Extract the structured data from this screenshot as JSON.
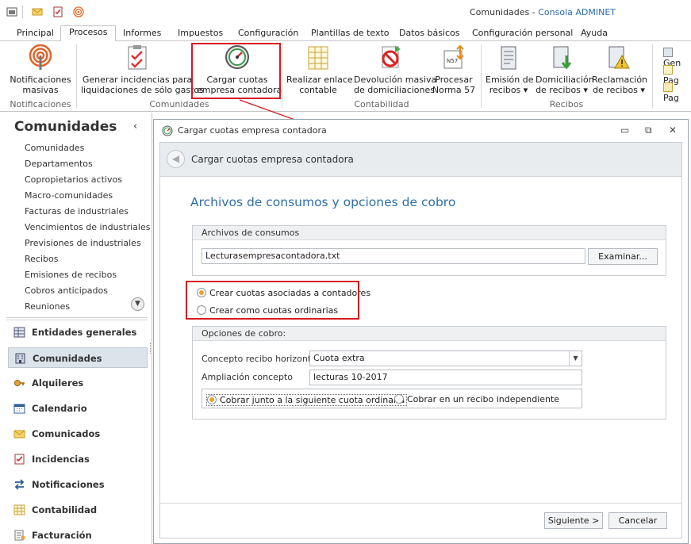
{
  "window": {
    "title_main": "Comunidades - ",
    "title_accent": "Consola ADMINET"
  },
  "ribbon_tabs": [
    "Principal",
    "Procesos",
    "Informes",
    "Impuestos",
    "Configuración",
    "Plantillas de texto",
    "Datos básicos",
    "Configuración personal",
    "Ayuda"
  ],
  "ribbon": {
    "buttons": {
      "notificaciones": "Notificaciones\nmasivas",
      "generar": "Generar incidencias para\nliquidaciones de sólo gastos",
      "cargar": "Cargar cuotas\nempresa contadora",
      "realizar": "Realizar enlace\ncontable",
      "devolucion": "Devolución masiva\nde domiciliaciones",
      "procesar": "Procesar\nNorma 57",
      "emision": "Emisión de\nrecibos ▾",
      "domiciliacion": "Domiciliación\nde recibos ▾",
      "reclamacion": "Reclamación\nde recibos ▾"
    },
    "groups": {
      "notificaciones": "Notificaciones",
      "comunidades": "Comunidades",
      "contabilidad": "Contabilidad",
      "recibos": "Recibos"
    },
    "small_buttons": [
      "Gen",
      "Pag",
      "Pag"
    ]
  },
  "leftnav": {
    "title": "Comunidades",
    "collapse_glyph": "‹",
    "sub_items": [
      "Comunidades",
      "Departamentos",
      "Copropietarios activos",
      "Macro-comunidades",
      "Facturas de industriales",
      "Vencimientos de industriales",
      "Previsiones de industriales",
      "Recibos",
      "Emisiones de recibos",
      "Cobros anticipados",
      "Reuniones"
    ],
    "main_items": [
      "Entidades generales",
      "Comunidades",
      "Alquileres",
      "Calendario",
      "Comunicados",
      "Incidencias",
      "Notificaciones",
      "Contabilidad",
      "Facturación"
    ]
  },
  "dialog": {
    "title": "Cargar cuotas empresa contadora",
    "header_title": "Cargar cuotas empresa contadora",
    "section_title": "Archivos de consumos y opciones de cobro",
    "archivos": {
      "heading": "Archivos de consumos",
      "file_value": "Lecturasempresacontadora.txt",
      "browse_label": "Examinar..."
    },
    "mode": {
      "option1": "Crear cuotas asociadas a contadores",
      "option2": "Crear como cuotas ordinarias",
      "selected": 1
    },
    "opciones": {
      "heading": "Opciones de cobro:",
      "concepto_label": "Concepto recibo horizontal:",
      "concepto_value": "Cuota extra",
      "ampliacion_label": "Ampliación concepto",
      "ampliacion_value": "lecturas 10-2017",
      "cobro_option1": "Cobrar junto a la siguiente cuota ordinaria",
      "cobro_option2": "Cobrar en un recibo independiente",
      "cobro_selected": 1
    },
    "next_label": "Siguiente >",
    "cancel_label": "Cancelar"
  },
  "colors": {
    "accent_blue": "#2f6ea8",
    "highlight_red": "#d71920",
    "radio_selected": "#e7a72c",
    "nav_active": "#dde3ea"
  }
}
